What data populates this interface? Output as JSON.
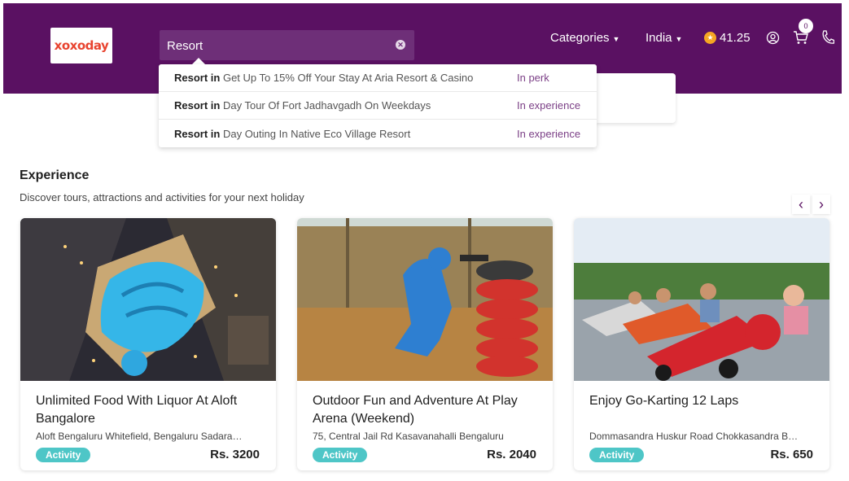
{
  "header": {
    "logo_text": "xoxoday",
    "search": {
      "value": "Resort"
    },
    "nav": {
      "categories": "Categories",
      "country": "India",
      "points": "41.25",
      "cart_count": "0"
    }
  },
  "suggestions": [
    {
      "prefix": "Resort in",
      "text": "Get Up To 15% Off Your Stay At Aria Resort & Casino",
      "category": "In perk"
    },
    {
      "prefix": "Resort in",
      "text": "Day Tour Of Fort Jadhavgadh On Weekdays",
      "category": "In experience"
    },
    {
      "prefix": "Resort in",
      "text": "Day Outing In Native Eco Village Resort",
      "category": "In experience"
    }
  ],
  "section": {
    "title": "Experience",
    "subtitle": "Discover tours, attractions and activities for your next holiday",
    "prev": "‹",
    "next": "›"
  },
  "cards": [
    {
      "title": "Unlimited Food With Liquor At Aloft Bangalore",
      "location": "Aloft Bengaluru Whitefield, Bengaluru Sadarahalli",
      "badge": "Activity",
      "price": "Rs. 3200"
    },
    {
      "title": "Outdoor Fun and Adventure At Play Arena (Weekend)",
      "location": "75, Central Jail Rd Kasavanahalli Bengaluru",
      "badge": "Activity",
      "price": "Rs. 2040"
    },
    {
      "title": "Enjoy Go-Karting 12 Laps",
      "location": "Dommasandra Huskur Road Chokkasandra Bengaluru",
      "badge": "Activity",
      "price": "Rs. 650"
    }
  ],
  "colors": {
    "header_bg": "#5a1162",
    "accent": "#7b3f86",
    "badge": "#4ec6c7",
    "logo": "#e8432f"
  },
  "icons": [
    "clear-search-icon",
    "chevron-down-icon",
    "coin-icon",
    "user-icon",
    "cart-icon",
    "phone-icon",
    "chevron-left-icon",
    "chevron-right-icon"
  ]
}
